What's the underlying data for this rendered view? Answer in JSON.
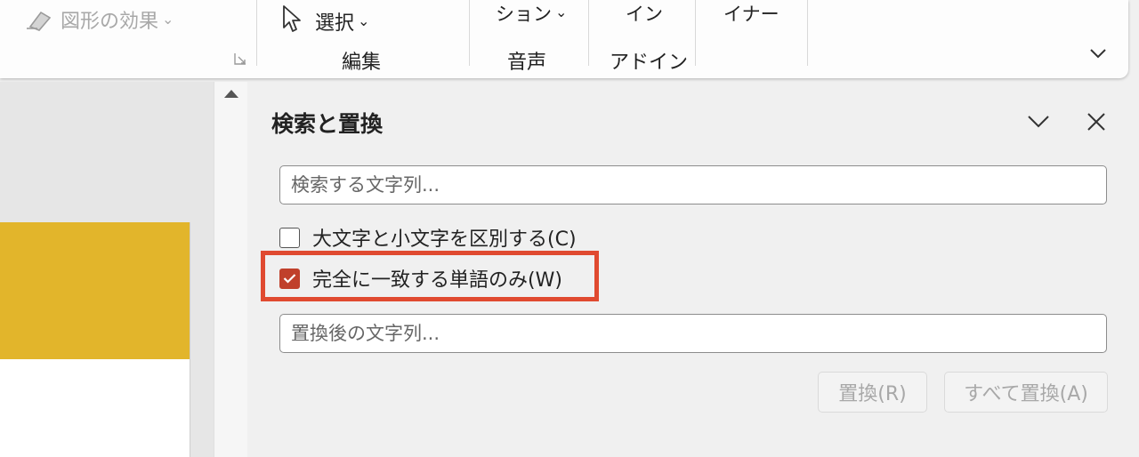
{
  "ribbon": {
    "shape_effects_label": "図形の効果",
    "select_label": "選択",
    "editing_group_label": "編集",
    "dictation_label": "ション",
    "voice_group_label": "音声",
    "addins_label": "イン",
    "addins_group_label": "アドイン",
    "designer_label": "イナー"
  },
  "pane": {
    "title": "検索と置換",
    "find_input": {
      "value": "",
      "placeholder": "検索する文字列..."
    },
    "match_case": {
      "label": "大文字と小文字を区別する(C)",
      "checked": false
    },
    "whole_words": {
      "label": "完全に一致する単語のみ(W)",
      "checked": true
    },
    "replace_input": {
      "value": "",
      "placeholder": "置換後の文字列..."
    },
    "replace_button": "置換(R)",
    "replace_all_button": "すべて置換(A)"
  },
  "colors": {
    "checkbox_accent": "#c0402b",
    "highlight": "#e04a30",
    "slide_shape": "#e2b52b"
  },
  "icons": [
    "shape-effects-icon",
    "dialog-launcher-icon",
    "select-cursor-icon",
    "chevron-down-icon",
    "ribbon-expand-icon",
    "scroll-up-icon",
    "pane-options-icon",
    "close-icon",
    "checkmark-icon"
  ]
}
